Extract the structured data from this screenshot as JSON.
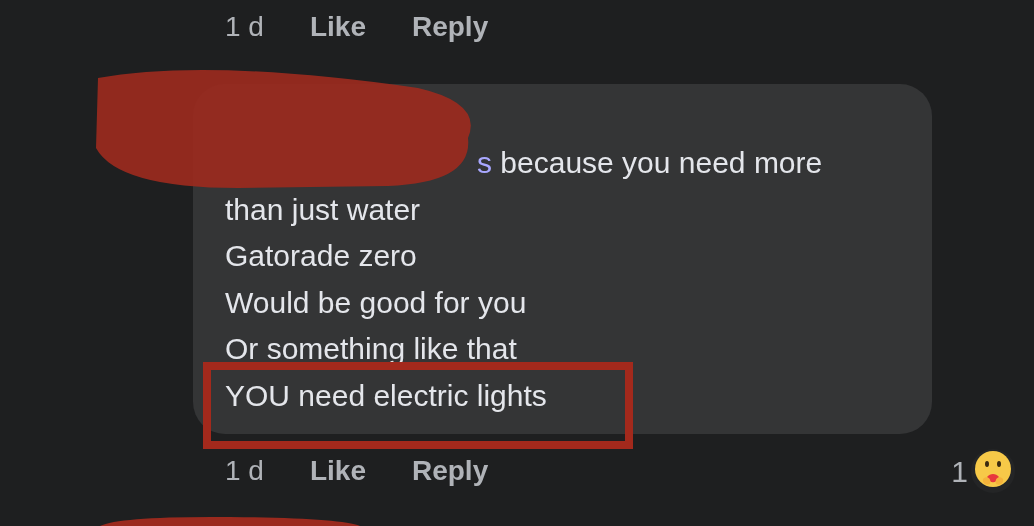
{
  "top_actions": {
    "time": "1 d",
    "like": "Like",
    "reply": "Reply"
  },
  "comment": {
    "author_redacted": true,
    "mention": "s",
    "lines": [
      {
        "text": "because you need more",
        "highlighted": false
      },
      {
        "text": "than just water",
        "highlighted": false
      },
      {
        "text": "Gatorade zero",
        "highlighted": false
      },
      {
        "text": "Would be good for you",
        "highlighted": false
      },
      {
        "text": "Or something like that",
        "highlighted": false
      },
      {
        "text": "YOU need electric lights",
        "highlighted": true
      }
    ]
  },
  "actions": {
    "time": "1 d",
    "like": "Like",
    "reply": "Reply"
  },
  "reactions": {
    "count": "1"
  },
  "next_comment": {
    "author_redacted": true
  }
}
